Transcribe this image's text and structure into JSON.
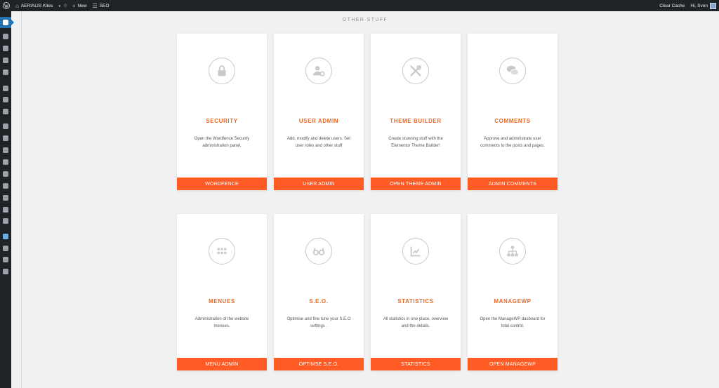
{
  "admin_bar": {
    "wp_logo_icon": "wordpress-logo-icon",
    "site_name": "AERIALIS Kites",
    "comments_count": "0",
    "new_label": "New",
    "seo_label": "SEO",
    "clear_cache_label": "Clear Cache",
    "greeting": "Hi, Sven"
  },
  "sidebar": {
    "icons": [
      "dashboard-icon",
      "posts-icon",
      "media-icon",
      "pages-icon",
      "comments-icon",
      "elementor-icon",
      "folders-icon",
      "templates-icon",
      "feedback-icon",
      "appearance-icon",
      "plugins-icon",
      "users-icon",
      "tools-icon",
      "settings-icon",
      "table-icon",
      "layout-icon",
      "seo-icon",
      "dashboard-active-icon",
      "pie-chart-icon",
      "vue-icon",
      "play-icon"
    ]
  },
  "section": {
    "title": "OTHER STUFF"
  },
  "cards": [
    {
      "title": "SECURITY",
      "description": "Open the Wordfence Security administration panel.",
      "button": "WORDFENCE",
      "icon": "lock-icon"
    },
    {
      "title": "USER ADMIN",
      "description": "Add, modify and delete users. Set user roles and other stuff",
      "button": "USER ADMIN",
      "icon": "user-gear-icon"
    },
    {
      "title": "THEME BUILDER",
      "description": "Create stunning stuff with the Elementor Theme Builder!",
      "button": "OPEN THEME ADMIN",
      "icon": "tools-icon"
    },
    {
      "title": "COMMENTS",
      "description": "Approve and administrate user comments to the posts and pages.",
      "button": "ADMIN COMMENTS",
      "icon": "chat-bubbles-icon"
    },
    {
      "title": "MENUES",
      "description": "Administration of the website menues.",
      "button": "MENU ADMIN",
      "icon": "grid-icon"
    },
    {
      "title": "S.E.O.",
      "description": "Optimise and fine tune your S.E.O settings .",
      "button": "OPTIMSE S.E.O.",
      "icon": "glasses-icon"
    },
    {
      "title": "STATISTICS",
      "description": "All statistics in one place, overview and the details.",
      "button": "STATISTICS",
      "icon": "chart-icon"
    },
    {
      "title": "MANAGEWP",
      "description": "Open the ManageWP dasboard for total control.",
      "button": "OPEN MANAGEWP",
      "icon": "sitemap-icon"
    }
  ],
  "colors": {
    "accent": "#ff5b24",
    "title": "#e86a28",
    "adminbar": "#1d2327",
    "active": "#2271b1"
  }
}
